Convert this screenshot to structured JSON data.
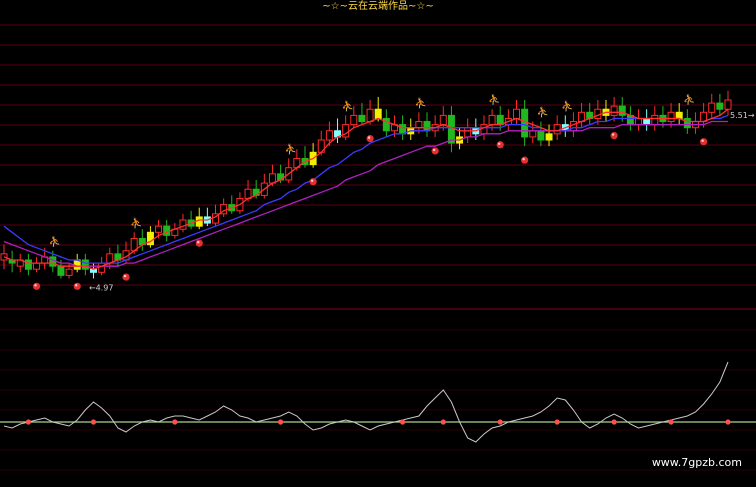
{
  "chart_title": "~☆~云在云端作品~☆~",
  "price_labels": {
    "low": "←4.97",
    "right": "5.51→"
  },
  "watermark": "www.7gpzb.com",
  "colors": {
    "background": "#000000",
    "up_candle": "#ff2a2a",
    "down_candle": "#1fb81f",
    "yellow_candle": "#f0f000",
    "cyan_candle": "#7fffff",
    "ma_short": "#ff3030",
    "ma_mid": "#3b3bff",
    "ma_long": "#b020c0",
    "grid": "#5a0012",
    "osc_line": "#c8c8c8",
    "baseline": "#b0d090",
    "marker": "#ff5050"
  },
  "chart_data": [
    {
      "type": "candlestick",
      "title": "",
      "candles": [
        [
          5.05,
          5.03,
          5.08,
          5.0,
          "up"
        ],
        [
          5.03,
          5.02,
          5.06,
          4.99,
          "down"
        ],
        [
          5.01,
          5.03,
          5.05,
          4.99,
          "up"
        ],
        [
          5.03,
          5.0,
          5.05,
          4.98,
          "down"
        ],
        [
          5.0,
          5.02,
          5.04,
          4.99,
          "up"
        ],
        [
          5.02,
          5.04,
          5.07,
          5.0,
          "up"
        ],
        [
          5.04,
          5.01,
          5.06,
          4.99,
          "down"
        ],
        [
          5.01,
          4.98,
          5.03,
          4.97,
          "down"
        ],
        [
          4.98,
          5.0,
          5.02,
          4.97,
          "up"
        ],
        [
          5.0,
          5.03,
          5.05,
          4.99,
          "yellow"
        ],
        [
          5.03,
          5.0,
          5.05,
          4.98,
          "down"
        ],
        [
          5.0,
          4.99,
          5.02,
          4.97,
          "cyan"
        ],
        [
          4.99,
          5.02,
          5.04,
          4.98,
          "up"
        ],
        [
          5.02,
          5.05,
          5.07,
          5.0,
          "up"
        ],
        [
          5.05,
          5.03,
          5.08,
          5.01,
          "down"
        ],
        [
          5.03,
          5.06,
          5.09,
          5.02,
          "up"
        ],
        [
          5.06,
          5.1,
          5.12,
          5.05,
          "up"
        ],
        [
          5.1,
          5.08,
          5.13,
          5.06,
          "down"
        ],
        [
          5.08,
          5.12,
          5.14,
          5.07,
          "yellow"
        ],
        [
          5.12,
          5.14,
          5.16,
          5.1,
          "up"
        ],
        [
          5.14,
          5.11,
          5.16,
          5.09,
          "down"
        ],
        [
          5.11,
          5.13,
          5.15,
          5.1,
          "up"
        ],
        [
          5.13,
          5.16,
          5.18,
          5.12,
          "up"
        ],
        [
          5.16,
          5.14,
          5.19,
          5.13,
          "down"
        ],
        [
          5.14,
          5.17,
          5.2,
          5.13,
          "yellow"
        ],
        [
          5.17,
          5.15,
          5.2,
          5.14,
          "cyan"
        ],
        [
          5.15,
          5.18,
          5.21,
          5.14,
          "up"
        ],
        [
          5.18,
          5.21,
          5.23,
          5.17,
          "up"
        ],
        [
          5.21,
          5.19,
          5.24,
          5.18,
          "down"
        ],
        [
          5.19,
          5.23,
          5.25,
          5.18,
          "up"
        ],
        [
          5.23,
          5.26,
          5.29,
          5.22,
          "up"
        ],
        [
          5.26,
          5.24,
          5.29,
          5.23,
          "down"
        ],
        [
          5.24,
          5.28,
          5.31,
          5.23,
          "up"
        ],
        [
          5.28,
          5.31,
          5.34,
          5.27,
          "up"
        ],
        [
          5.31,
          5.29,
          5.34,
          5.28,
          "down"
        ],
        [
          5.29,
          5.33,
          5.36,
          5.28,
          "up"
        ],
        [
          5.33,
          5.36,
          5.39,
          5.32,
          "up"
        ],
        [
          5.36,
          5.34,
          5.4,
          5.33,
          "down"
        ],
        [
          5.34,
          5.38,
          5.41,
          5.33,
          "yellow"
        ],
        [
          5.38,
          5.42,
          5.45,
          5.37,
          "up"
        ],
        [
          5.42,
          5.45,
          5.48,
          5.4,
          "up"
        ],
        [
          5.45,
          5.43,
          5.49,
          5.41,
          "cyan"
        ],
        [
          5.43,
          5.47,
          5.5,
          5.42,
          "up"
        ],
        [
          5.47,
          5.5,
          5.53,
          5.46,
          "up"
        ],
        [
          5.5,
          5.48,
          5.54,
          5.47,
          "down"
        ],
        [
          5.48,
          5.52,
          5.55,
          5.47,
          "up"
        ],
        [
          5.52,
          5.49,
          5.56,
          5.48,
          "yellow"
        ],
        [
          5.49,
          5.45,
          5.52,
          5.43,
          "down"
        ],
        [
          5.45,
          5.47,
          5.5,
          5.43,
          "up"
        ],
        [
          5.47,
          5.44,
          5.5,
          5.42,
          "down"
        ],
        [
          5.44,
          5.46,
          5.49,
          5.42,
          "yellow"
        ],
        [
          5.46,
          5.48,
          5.51,
          5.44,
          "up"
        ],
        [
          5.48,
          5.45,
          5.51,
          5.43,
          "down"
        ],
        [
          5.45,
          5.47,
          5.5,
          5.43,
          "up"
        ],
        [
          5.47,
          5.5,
          5.53,
          5.45,
          "up"
        ],
        [
          5.5,
          5.41,
          5.53,
          5.38,
          "down"
        ],
        [
          5.41,
          5.43,
          5.46,
          5.39,
          "yellow"
        ],
        [
          5.43,
          5.46,
          5.49,
          5.41,
          "up"
        ],
        [
          5.46,
          5.44,
          5.49,
          5.42,
          "cyan"
        ],
        [
          5.44,
          5.47,
          5.5,
          5.42,
          "up"
        ],
        [
          5.47,
          5.5,
          5.52,
          5.45,
          "up"
        ],
        [
          5.5,
          5.47,
          5.53,
          5.45,
          "down"
        ],
        [
          5.47,
          5.49,
          5.52,
          5.45,
          "up"
        ],
        [
          5.49,
          5.52,
          5.55,
          5.47,
          "up"
        ],
        [
          5.52,
          5.43,
          5.55,
          5.4,
          "down"
        ],
        [
          5.43,
          5.45,
          5.48,
          5.41,
          "up"
        ],
        [
          5.45,
          5.42,
          5.48,
          5.4,
          "down"
        ],
        [
          5.42,
          5.44,
          5.47,
          5.4,
          "yellow"
        ],
        [
          5.44,
          5.47,
          5.5,
          5.42,
          "up"
        ],
        [
          5.47,
          5.45,
          5.5,
          5.43,
          "cyan"
        ],
        [
          5.45,
          5.48,
          5.51,
          5.43,
          "up"
        ],
        [
          5.48,
          5.51,
          5.54,
          5.46,
          "up"
        ],
        [
          5.51,
          5.49,
          5.54,
          5.47,
          "down"
        ],
        [
          5.49,
          5.52,
          5.55,
          5.47,
          "up"
        ],
        [
          5.52,
          5.5,
          5.55,
          5.48,
          "yellow"
        ],
        [
          5.5,
          5.53,
          5.56,
          5.48,
          "up"
        ],
        [
          5.53,
          5.5,
          5.56,
          5.48,
          "down"
        ],
        [
          5.5,
          5.47,
          5.53,
          5.45,
          "down"
        ],
        [
          5.47,
          5.49,
          5.52,
          5.45,
          "up"
        ],
        [
          5.49,
          5.47,
          5.52,
          5.45,
          "cyan"
        ],
        [
          5.47,
          5.5,
          5.53,
          5.45,
          "up"
        ],
        [
          5.5,
          5.48,
          5.53,
          5.46,
          "down"
        ],
        [
          5.48,
          5.51,
          5.54,
          5.46,
          "up"
        ],
        [
          5.51,
          5.49,
          5.54,
          5.47,
          "yellow"
        ],
        [
          5.49,
          5.46,
          5.52,
          5.44,
          "down"
        ],
        [
          5.46,
          5.48,
          5.51,
          5.44,
          "up"
        ],
        [
          5.48,
          5.51,
          5.54,
          5.46,
          "up"
        ],
        [
          5.51,
          5.54,
          5.57,
          5.49,
          "up"
        ],
        [
          5.54,
          5.52,
          5.57,
          5.5,
          "down"
        ],
        [
          5.52,
          5.55,
          5.58,
          5.5,
          "up"
        ]
      ],
      "ma_short": [
        5.04,
        5.03,
        5.03,
        5.02,
        5.02,
        5.02,
        5.02,
        5.01,
        5.01,
        5.01,
        5.01,
        5.0,
        5.01,
        5.02,
        5.03,
        5.04,
        5.06,
        5.08,
        5.09,
        5.11,
        5.12,
        5.13,
        5.14,
        5.15,
        5.16,
        5.16,
        5.17,
        5.19,
        5.2,
        5.21,
        5.23,
        5.24,
        5.26,
        5.28,
        5.29,
        5.31,
        5.33,
        5.35,
        5.36,
        5.38,
        5.41,
        5.43,
        5.44,
        5.46,
        5.47,
        5.48,
        5.49,
        5.48,
        5.47,
        5.46,
        5.46,
        5.46,
        5.46,
        5.46,
        5.47,
        5.46,
        5.45,
        5.45,
        5.45,
        5.46,
        5.47,
        5.47,
        5.48,
        5.49,
        5.48,
        5.47,
        5.46,
        5.45,
        5.45,
        5.46,
        5.47,
        5.48,
        5.49,
        5.5,
        5.51,
        5.51,
        5.51,
        5.5,
        5.49,
        5.49,
        5.49,
        5.49,
        5.49,
        5.49,
        5.48,
        5.48,
        5.48,
        5.49,
        5.5,
        5.52
      ],
      "ma_mid": [
        5.14,
        5.12,
        5.1,
        5.08,
        5.07,
        5.06,
        5.05,
        5.04,
        5.03,
        5.03,
        5.02,
        5.02,
        5.02,
        5.02,
        5.02,
        5.03,
        5.04,
        5.05,
        5.06,
        5.07,
        5.08,
        5.09,
        5.1,
        5.11,
        5.12,
        5.13,
        5.14,
        5.15,
        5.16,
        5.17,
        5.18,
        5.19,
        5.21,
        5.22,
        5.23,
        5.25,
        5.26,
        5.28,
        5.29,
        5.31,
        5.33,
        5.34,
        5.36,
        5.38,
        5.39,
        5.41,
        5.42,
        5.43,
        5.44,
        5.44,
        5.45,
        5.45,
        5.45,
        5.46,
        5.46,
        5.46,
        5.46,
        5.46,
        5.46,
        5.46,
        5.46,
        5.46,
        5.47,
        5.47,
        5.47,
        5.46,
        5.46,
        5.45,
        5.45,
        5.45,
        5.46,
        5.46,
        5.47,
        5.48,
        5.48,
        5.49,
        5.49,
        5.49,
        5.49,
        5.49,
        5.49,
        5.49,
        5.49,
        5.49,
        5.48,
        5.48,
        5.48,
        5.49,
        5.49,
        5.5
      ],
      "ma_long": [
        5.09,
        5.08,
        5.07,
        5.06,
        5.05,
        5.04,
        5.03,
        5.02,
        5.02,
        5.01,
        5.01,
        5.01,
        5.01,
        5.01,
        5.01,
        5.02,
        5.02,
        5.03,
        5.04,
        5.05,
        5.06,
        5.07,
        5.08,
        5.09,
        5.1,
        5.11,
        5.12,
        5.13,
        5.14,
        5.15,
        5.16,
        5.17,
        5.18,
        5.19,
        5.2,
        5.21,
        5.22,
        5.23,
        5.24,
        5.25,
        5.26,
        5.27,
        5.29,
        5.3,
        5.31,
        5.32,
        5.34,
        5.35,
        5.36,
        5.37,
        5.38,
        5.39,
        5.4,
        5.4,
        5.41,
        5.42,
        5.42,
        5.43,
        5.43,
        5.44,
        5.44,
        5.44,
        5.45,
        5.45,
        5.45,
        5.45,
        5.45,
        5.45,
        5.45,
        5.45,
        5.45,
        5.45,
        5.46,
        5.46,
        5.46,
        5.46,
        5.47,
        5.47,
        5.47,
        5.47,
        5.47,
        5.47,
        5.47,
        5.47,
        5.47,
        5.47,
        5.47,
        5.48,
        5.48,
        5.48
      ],
      "buy_signal_indices": [
        6,
        16,
        35,
        42,
        51,
        60,
        66,
        69,
        84
      ],
      "sell_marker_indices": [
        4,
        9,
        15,
        24,
        38,
        45,
        53,
        61,
        64,
        75,
        86
      ]
    },
    {
      "type": "line",
      "title": "",
      "baseline": 0,
      "values": [
        -2,
        -3,
        -1,
        0,
        1,
        2,
        0,
        -1,
        -2,
        1,
        6,
        10,
        7,
        3,
        -3,
        -5,
        -2,
        0,
        1,
        0,
        2,
        3,
        3,
        2,
        1,
        3,
        5,
        8,
        6,
        3,
        2,
        0,
        1,
        2,
        3,
        5,
        3,
        -1,
        -4,
        -3,
        -1,
        0,
        1,
        0,
        -2,
        -4,
        -2,
        -1,
        0,
        1,
        2,
        3,
        8,
        12,
        16,
        10,
        0,
        -8,
        -10,
        -6,
        -3,
        -2,
        0,
        1,
        2,
        3,
        5,
        8,
        12,
        11,
        6,
        0,
        -3,
        -1,
        2,
        4,
        2,
        -1,
        -3,
        -2,
        -1,
        0,
        1,
        2,
        3,
        5,
        9,
        14,
        20,
        30
      ],
      "marker_indices": [
        3,
        11,
        21,
        34,
        49,
        54,
        61,
        68,
        75,
        82,
        89
      ]
    }
  ]
}
